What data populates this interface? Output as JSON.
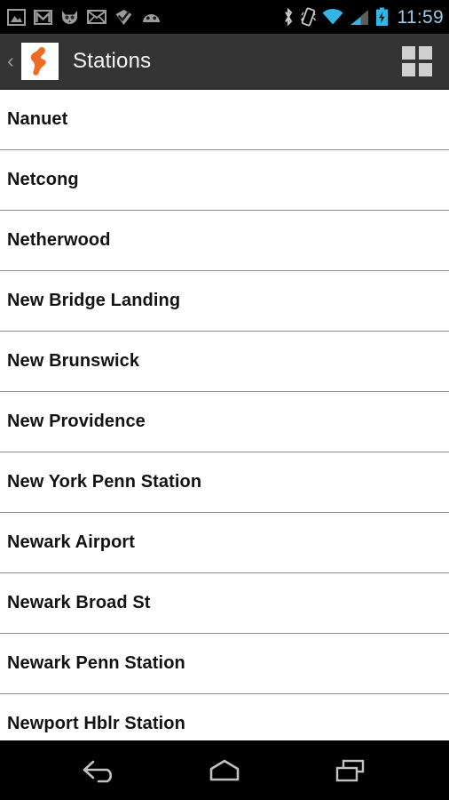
{
  "status_bar": {
    "background": "#000000",
    "clock": "11:59",
    "clock_color": "#9ec8e3",
    "left_icons": [
      {
        "name": "screenshot-image-icon",
        "label": "Screenshot"
      },
      {
        "name": "gmail-icon",
        "label": "Gmail"
      },
      {
        "name": "cat-face-icon",
        "label": "Messaging"
      },
      {
        "name": "email-envelope-icon",
        "label": "Email"
      },
      {
        "name": "checkmark-badge-icon",
        "label": "Foursquare"
      },
      {
        "name": "android-head-icon",
        "label": "CyanogenMod"
      }
    ],
    "right_icons": [
      {
        "name": "bluetooth-icon",
        "label": "Bluetooth"
      },
      {
        "name": "vibrate-icon",
        "label": "Vibrate mode"
      },
      {
        "name": "wifi-icon",
        "label": "Wi-Fi",
        "color": "#33b5e5"
      },
      {
        "name": "cell-signal-icon",
        "label": "Cellular signal"
      },
      {
        "name": "battery-charging-icon",
        "label": "Battery charging",
        "color": "#33b5e5"
      }
    ]
  },
  "action_bar": {
    "background": "#343434",
    "up_chevron": "‹",
    "app_icon_name": "new-jersey-state-icon",
    "app_icon_color": "#ED6B23",
    "title": "Stations",
    "grid_button_name": "grid-view-button"
  },
  "list": {
    "items": [
      {
        "label": "Nanuet"
      },
      {
        "label": "Netcong"
      },
      {
        "label": "Netherwood"
      },
      {
        "label": "New Bridge Landing"
      },
      {
        "label": "New Brunswick"
      },
      {
        "label": "New Providence"
      },
      {
        "label": "New York Penn Station"
      },
      {
        "label": "Newark Airport"
      },
      {
        "label": "Newark Broad St"
      },
      {
        "label": "Newark Penn Station"
      },
      {
        "label": "Newport Hblr Station"
      }
    ]
  },
  "nav_bar": {
    "background": "#000000",
    "buttons": [
      {
        "name": "back-button",
        "label": "Back"
      },
      {
        "name": "home-button",
        "label": "Home"
      },
      {
        "name": "recents-button",
        "label": "Recent apps"
      }
    ]
  }
}
